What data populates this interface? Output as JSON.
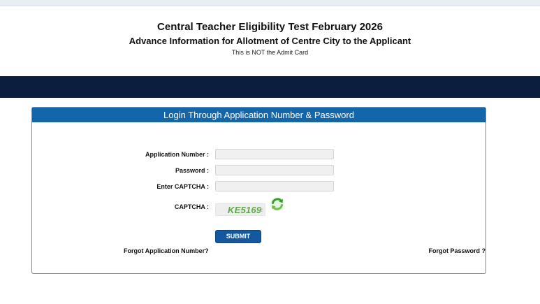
{
  "header": {
    "title": "Central Teacher Eligibility Test February 2026",
    "subtitle": "Advance Information for Allotment of Centre City to the Applicant",
    "note": "This is NOT the Admit Card"
  },
  "login": {
    "panel_title": "Login Through Application Number & Password",
    "fields": [
      {
        "label": "Application Number :",
        "value": "",
        "placeholder": ""
      },
      {
        "label": "Password :",
        "value": "",
        "placeholder": ""
      },
      {
        "label": "Enter CAPTCHA :",
        "value": "",
        "placeholder": ""
      }
    ],
    "captcha_label": "CAPTCHA :",
    "captcha_code": "KE5169",
    "captcha_faint": "·z",
    "refresh_icon": "refresh-icon",
    "submit_label": "SUBMIT",
    "forgot_application": "Forgot Application Number?",
    "forgot_password": "Forgot Password ?"
  },
  "colors": {
    "nav_bar": "#0b1e3d",
    "panel_header": "#1466ab",
    "submit": "#1459a0",
    "captcha_text": "#5fa84a",
    "refresh_icon": "#4caf50"
  }
}
